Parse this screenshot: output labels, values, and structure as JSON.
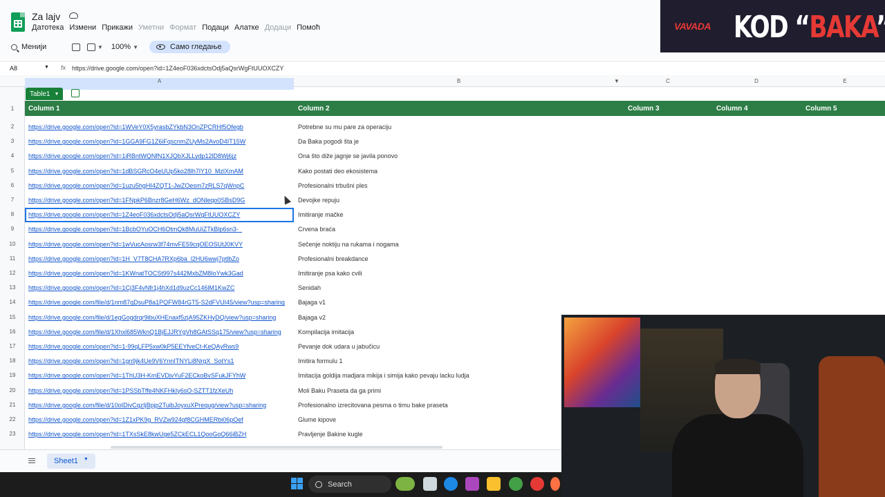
{
  "doc": {
    "title": "Za lajv"
  },
  "menu": {
    "items": [
      {
        "label": "Датотека",
        "disabled": false
      },
      {
        "label": "Измени",
        "disabled": false
      },
      {
        "label": "Прикажи",
        "disabled": false
      },
      {
        "label": "Уметни",
        "disabled": true
      },
      {
        "label": "Формат",
        "disabled": true
      },
      {
        "label": "Подаци",
        "disabled": false
      },
      {
        "label": "Алатке",
        "disabled": false
      },
      {
        "label": "Додаци",
        "disabled": true
      },
      {
        "label": "Помоћ",
        "disabled": false
      }
    ]
  },
  "toolbar": {
    "menus_label": "Менији",
    "zoom": "100%",
    "view_only": "Само гледање"
  },
  "formula_bar": {
    "cell_ref": "A8",
    "fx": "fx",
    "value": "https://drive.google.com/open?id=1Z4eoF036xdctsOdj5aQsrWgFtUUOXCZY"
  },
  "columns": {
    "letters": [
      "A",
      "B",
      "C",
      "D",
      "E"
    ],
    "headers": [
      "Column 1",
      "Column 2",
      "Column 3",
      "Column 4",
      "Column 5"
    ]
  },
  "table_name": "Table1",
  "selected_row": 8,
  "rows": [
    {
      "n": "2",
      "a": "https://drive.google.com/open?id=1WVeY0X5yrasbZYkbN3OnZPCRHf5Ofegb",
      "b": "Potrebne su mu pare za operaciju"
    },
    {
      "n": "3",
      "a": "https://drive.google.com/open?id=1GGA9FG1Z6iFqscnmZUyMs2AvoD4IT15W",
      "b": "Da Baka pogodi šta je"
    },
    {
      "n": "4",
      "a": "https://drive.google.com/open?id=1iRBntWQNfN1XJQbXJLLydp12lD8Wj6jz",
      "b": "Ona što diže jagnje se javila ponovo"
    },
    {
      "n": "5",
      "a": "https://drive.google.com/open?id=1dBSGRcO4eUUp5ko28lh7lY10_MzlXmAM",
      "b": "Kako postati deo ekosistema"
    },
    {
      "n": "6",
      "a": "https://drive.google.com/open?id=1uzu5hgHI4ZQT1-JwZOesm7zRLS7qWnpC",
      "b": "Profesionalni trbušni ples"
    },
    {
      "n": "7",
      "a": "https://drive.google.com/open?id=1FNpkP6Bnzr8GeH6Wz_dONleqo0SBsD9G",
      "b": "Devojke repuju"
    },
    {
      "n": "8",
      "a": "https://drive.google.com/open?id=1Z4eoF036xdctsOdj5aQsrWgFtUUOXCZY",
      "b": "Imitiranje mačke"
    },
    {
      "n": "9",
      "a": "https://drive.google.com/open?id=1BcbOYuOCH6OtmQk8MuUiZTkBlp6sn3-_",
      "b": "Crvena braća"
    },
    {
      "n": "10",
      "a": "https://drive.google.com/open?id=1wVucAosrw3f74mvFE59cqOEOSUtJ0KVY",
      "b": "Sečenje noktiju na rukama i nogama"
    },
    {
      "n": "11",
      "a": "https://drive.google.com/open?id=1H_V7T8CHA7RXp6ba_l2HU6wwj7ptlbZo",
      "b": "Profesionalni breakdance"
    },
    {
      "n": "12",
      "a": "https://drive.google.com/open?id=1KWnatTOCSt997s442MxbZM8IoYwk3Gad",
      "b": "Imitiranje psa kako cvili"
    },
    {
      "n": "13",
      "a": "https://drive.google.com/open?id=1Cj3F4vNfr1j4hXd1d9uzCc146lM1KwZC",
      "b": "Senidah"
    },
    {
      "n": "14",
      "a": "https://drive.google.com/file/d/1nm87qDsuP8a1PQFW84rGT5-S2dFVUI45/view?usp=sharing",
      "b": "Bajaga v1"
    },
    {
      "n": "15",
      "a": "https://drive.google.com/file/d/1egGogdrqr9ibuXHEnaxf5zjA95ZKHyDQ/view?usp=sharing",
      "b": "Bajaga v2"
    },
    {
      "n": "16",
      "a": "https://drive.google.com/file/d/1Xhxl685WknQ1BjEJJRYgVh8GAtSSq175/view?usp=sharing",
      "b": "Kompilacija imitacija"
    },
    {
      "n": "17",
      "a": "https://drive.google.com/open?id=1-99qLFP5xw0kP5EEYfveCt-KeQAyRws9",
      "b": "Pevanje dok udara u jabučicu"
    },
    {
      "n": "18",
      "a": "https://drive.google.com/open?id=1gn9jk4Ue9V6YnnITNYLi8NrgX_SotYs1",
      "b": "Imitira formulu 1"
    },
    {
      "n": "19",
      "a": "https://drive.google.com/open?id=1ThU3H-KmEVDjvYuF2ECkoBvSFukJFYhW",
      "b": "Imitacija goldija madjara mikija i simija kako pevaju lacku ludja"
    },
    {
      "n": "20",
      "a": "https://drive.google.com/open?id=1PSSbTffe4NKFHkIy6sO-SZTT1fzXeUh",
      "b": "Moli Baku Praseta da ga primi"
    },
    {
      "n": "21",
      "a": "https://drive.google.com/file/d/10oIDivCqzIjBpjp2TuibJoyxuXPrequg/view?usp=sharing",
      "b": "Profesionalno izrecitovana pesma o timu bake praseta"
    },
    {
      "n": "22",
      "a": "https://drive.google.com/open?id=1Z1xPK9g_RVZw924gf8CGHMERbi06pOef",
      "b": "Glume kipove"
    },
    {
      "n": "23",
      "a": "https://drive.google.com/open?id=1TXsSkE8kwUge5ZCkECL1QooGoQ66iBZH",
      "b": "Pravljenje Bakine kugle"
    }
  ],
  "sheet_tab": "Sheet1",
  "taskbar": {
    "search_label": "Search"
  },
  "promo": {
    "brand": "VAVADA",
    "text_prefix": "KOD “",
    "text_red": "BAKA",
    "text_suffix": "”"
  },
  "colors": {
    "table_header": "#2d7d46",
    "link": "#1155cc",
    "accent": "#1a73e8",
    "promo_red": "#e53935"
  }
}
